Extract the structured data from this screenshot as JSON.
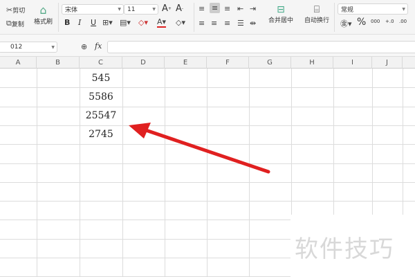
{
  "ribbon": {
    "cut": "剪切",
    "copy": "复制",
    "format_painter": "格式刷",
    "font_name": "宋体",
    "font_size": "11",
    "bold": "B",
    "italic": "I",
    "underline": "U",
    "merge_center": "合并居中",
    "wrap_text": "自动换行",
    "number_format": "常规",
    "percent": "%",
    "thousands": "000",
    "inc_decimal": "+.0",
    "dec_decimal": ".00"
  },
  "formula_bar": {
    "name_box": "012",
    "zoom_icon": "magnifier-icon",
    "fx": "fx",
    "formula": ""
  },
  "columns": [
    "A",
    "B",
    "C",
    "D",
    "E",
    "F",
    "G",
    "H",
    "I",
    "J"
  ],
  "cells": [
    {
      "ref": "C1",
      "value": "545"
    },
    {
      "ref": "C2",
      "value": "5586"
    },
    {
      "ref": "C3",
      "value": "25547"
    },
    {
      "ref": "C4",
      "value": "2745"
    }
  ],
  "watermark": "软件技巧",
  "colors": {
    "arrow": "#e02020",
    "grid": "#dcdcdc",
    "ribbon": "#f5f5f5"
  }
}
